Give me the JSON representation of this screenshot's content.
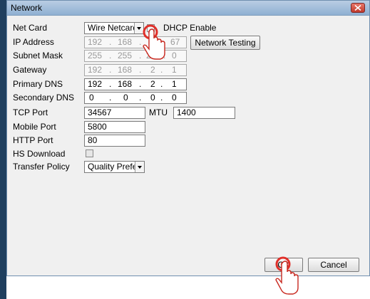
{
  "window": {
    "title": "Network"
  },
  "labels": {
    "net_card": "Net Card",
    "ip_address": "IP Address",
    "subnet_mask": "Subnet Mask",
    "gateway": "Gateway",
    "primary_dns": "Primary DNS",
    "secondary_dns": "Secondary DNS",
    "tcp_port": "TCP Port",
    "mtu": "MTU",
    "mobile_port": "Mobile Port",
    "http_port": "HTTP Port",
    "hs_download": "HS Download",
    "transfer_policy": "Transfer Policy"
  },
  "net_card": {
    "value": "Wire Netcard",
    "dhcp_label": "DHCP Enable"
  },
  "ip_address": {
    "o1": "192",
    "o2": "168",
    "o3": "2",
    "o4": "67"
  },
  "subnet_mask": {
    "o1": "255",
    "o2": "255",
    "o3": "255",
    "o4": "0"
  },
  "gateway": {
    "o1": "192",
    "o2": "168",
    "o3": "2",
    "o4": "1"
  },
  "primary_dns": {
    "o1": "192",
    "o2": "168",
    "o3": "2",
    "o4": "1"
  },
  "secondary_dns": {
    "o1": "0",
    "o2": "0",
    "o3": "0",
    "o4": "0"
  },
  "dot": ".",
  "tcp_port": {
    "value": "34567"
  },
  "mtu": {
    "value": "1400"
  },
  "mobile_port": {
    "value": "5800"
  },
  "http_port": {
    "value": "80"
  },
  "transfer_policy": {
    "value": "Quality Prefe"
  },
  "buttons": {
    "network_testing": "Network Testing",
    "ok": "OK",
    "cancel": "Cancel"
  },
  "icons": {
    "close": "close-icon",
    "cursor": "hand-pointer-icon"
  }
}
